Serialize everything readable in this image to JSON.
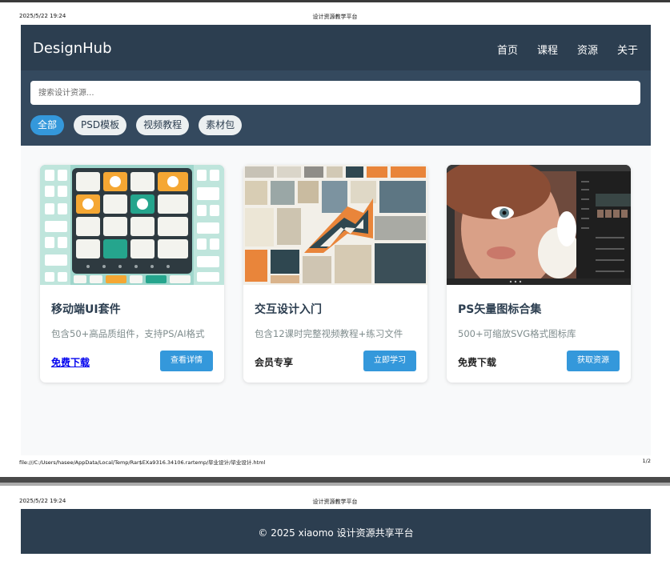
{
  "print": {
    "date": "2025/5/22 19:24",
    "doc_title": "设计资源教学平台",
    "file_path": "file:///C:/Users/hasee/AppData/Local/Temp/Rar$EXa9316.34106.rartemp/毕业设计/毕业设计.html",
    "page_indicator": "1/2"
  },
  "navbar": {
    "logo": "DesignHub",
    "links": [
      "首页",
      "课程",
      "资源",
      "关于"
    ]
  },
  "search": {
    "placeholder": "搜索设计资源..."
  },
  "filters": {
    "chips": [
      "全部",
      "PSD模板",
      "视频教程",
      "素材包"
    ],
    "active_index": 0
  },
  "cards": [
    {
      "title": "移动端UI套件",
      "desc": "包含50+高品质组件，支持PS/AI格式",
      "price": "免费下载",
      "button": "查看详情"
    },
    {
      "title": "交互设计入门",
      "desc": "包含12课时完整视频教程+练习文件",
      "price": "会员专享",
      "button": "立即学习"
    },
    {
      "title": "PS矢量图标合集",
      "desc": "500+可缩放SVG格式图标库",
      "price": "免费下载",
      "button": "获取资源"
    }
  ],
  "footer": {
    "text": "© 2025 xiaomo 设计资源共享平台"
  },
  "colors": {
    "navbar": "#2c3e50",
    "filter_bg": "#34495e",
    "accent": "#3498db",
    "chip_bg": "#ecf0f1"
  }
}
